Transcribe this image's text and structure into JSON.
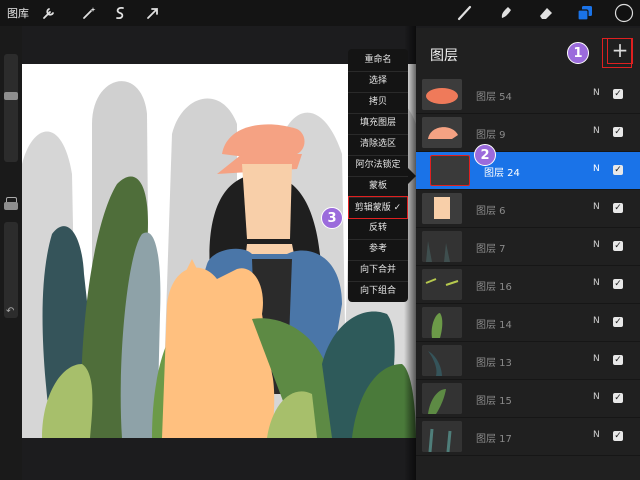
{
  "toolbar": {
    "gallery_label": "图库",
    "left_icons": [
      "wrench-icon",
      "magic-wand-icon",
      "selection-s-icon",
      "transform-arrow-icon"
    ],
    "right_icons": [
      "brush-icon",
      "smudge-icon",
      "eraser-icon",
      "layers-icon",
      "color-swatch-icon"
    ]
  },
  "context_menu": {
    "items": [
      "重命名",
      "选择",
      "拷贝",
      "填充图层",
      "清除选区",
      "阿尔法锁定",
      "蒙板",
      "剪辑蒙版 ✓",
      "反转",
      "参考",
      "向下合并",
      "向下组合"
    ],
    "selected_index": 7
  },
  "layers_panel": {
    "title": "图层",
    "add_label": "+",
    "layers": [
      {
        "name": "图层 54",
        "mode": "N",
        "checked": "✓"
      },
      {
        "name": "图层 9",
        "mode": "N",
        "checked": "✓"
      },
      {
        "name": "图层 24",
        "mode": "N",
        "checked": "✓"
      },
      {
        "name": "图层 6",
        "mode": "N",
        "checked": "✓"
      },
      {
        "name": "图层 7",
        "mode": "N",
        "checked": "✓"
      },
      {
        "name": "图层 16",
        "mode": "N",
        "checked": "✓"
      },
      {
        "name": "图层 14",
        "mode": "N",
        "checked": "✓"
      },
      {
        "name": "图层 13",
        "mode": "N",
        "checked": "✓"
      },
      {
        "name": "图层 15",
        "mode": "N",
        "checked": "✓"
      },
      {
        "name": "图层 17",
        "mode": "N",
        "checked": "✓"
      }
    ],
    "active_index": 2
  },
  "annotations": [
    "1",
    "2",
    "3"
  ],
  "colors": {
    "accent_blue": "#1a73e8",
    "highlight_red": "#e02020",
    "badge_purple": "#9b6bdc"
  }
}
